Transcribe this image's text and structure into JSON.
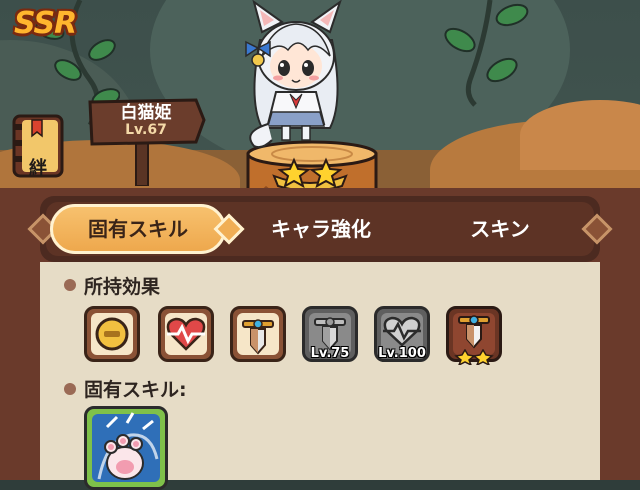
{
  "character": {
    "rarity": "SSR",
    "name": "白猫姫",
    "level": "Lv.67",
    "stars": 2
  },
  "bond_button": {
    "label": "絆",
    "icon": "bond-book-icon"
  },
  "tabs": [
    {
      "label": "固有スキル",
      "active": true
    },
    {
      "label": "キャラ強化",
      "active": false
    },
    {
      "label": "スキン",
      "active": false
    }
  ],
  "owned_effects": {
    "title": "所持効果",
    "items": [
      {
        "icon": "coin-icon",
        "style": "brown",
        "level": ""
      },
      {
        "icon": "heart-icon",
        "style": "brown",
        "level": ""
      },
      {
        "icon": "sword-icon",
        "style": "brown",
        "level": ""
      },
      {
        "icon": "sword-icon",
        "style": "gray",
        "level": "Lv.75"
      },
      {
        "icon": "heart-icon",
        "style": "gray",
        "level": "Lv.100"
      },
      {
        "icon": "sword-icon",
        "style": "gold",
        "level": "",
        "stars": 2
      }
    ]
  },
  "unique_skill": {
    "title": "固有スキル:",
    "icon": "cat-paw-icon"
  },
  "colors": {
    "rarity": "#ffb62e",
    "active_tab": "#f0ae55",
    "panel": "#e6dcc6",
    "frame": "#6a3a2b"
  }
}
